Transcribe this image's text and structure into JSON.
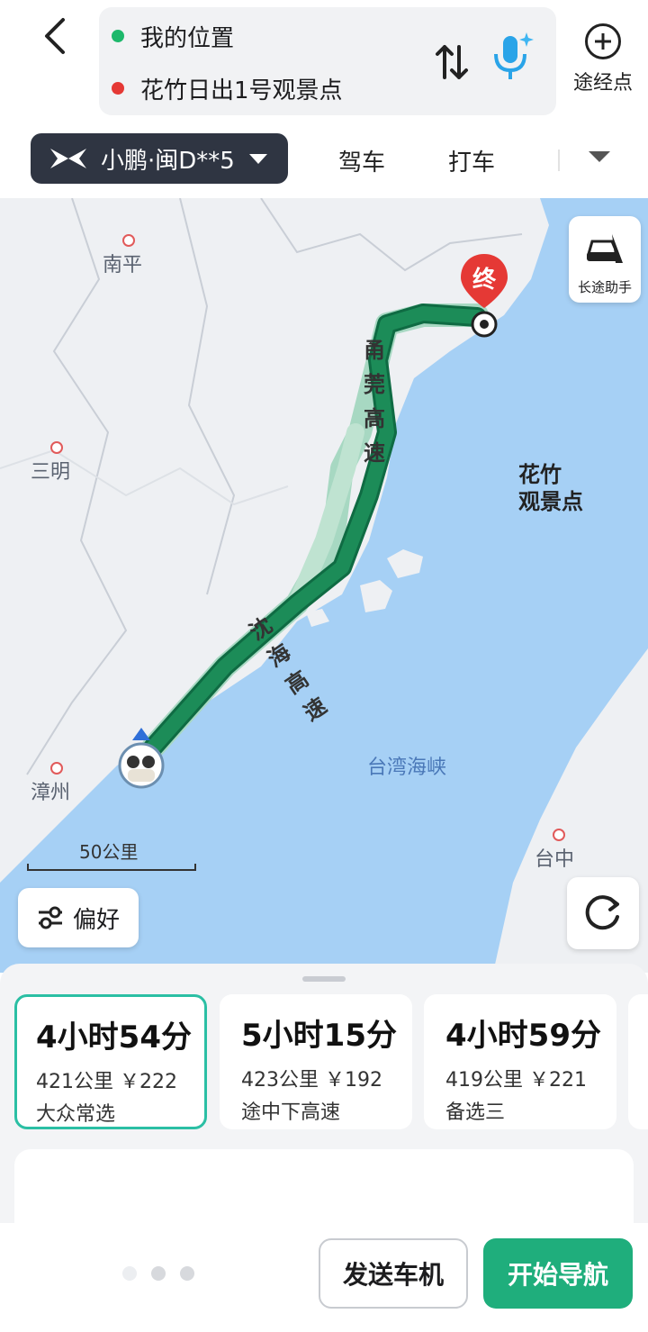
{
  "header": {
    "origin": "我的位置",
    "destination": "花竹日出1号观景点",
    "via_label": "途经点"
  },
  "tabs": {
    "vehicle": "小鹏·闽D**5",
    "drive": "驾车",
    "taxi": "打车"
  },
  "map": {
    "cities": [
      "南平",
      "三明",
      "漳州",
      "台中"
    ],
    "roads": [
      "甬莞高速",
      "沈海高速"
    ],
    "strait": "台湾海峡",
    "scale": "50公里",
    "end_marker": "终",
    "destination_label_line1": "花竹",
    "destination_label_line2": "观景点",
    "long_trip": "长途助手",
    "preference": "偏好"
  },
  "routes": [
    {
      "time": "4小时54分",
      "distance": "421公里",
      "cost": "￥222",
      "tag": "大众常选"
    },
    {
      "time": "5小时15分",
      "distance": "423公里",
      "cost": "￥192",
      "tag": "途中下高速"
    },
    {
      "time": "4小时59分",
      "distance": "419公里",
      "cost": "￥221",
      "tag": "备选三"
    }
  ],
  "actions": {
    "send": "发送车机",
    "start": "开始导航"
  },
  "colors": {
    "origin_dot": "#1db86b",
    "dest_dot": "#e53935",
    "route": "#1c8c58",
    "accent": "#1fae7c",
    "selected_border": "#2bbfa4",
    "sea": "#a6d0f5"
  },
  "icons": [
    "back-icon",
    "swap-icon",
    "mic-icon",
    "plus-icon",
    "car-icon",
    "car-brand-icon",
    "sliders-icon",
    "refresh-icon",
    "end-pin-icon",
    "start-avatar-icon"
  ]
}
